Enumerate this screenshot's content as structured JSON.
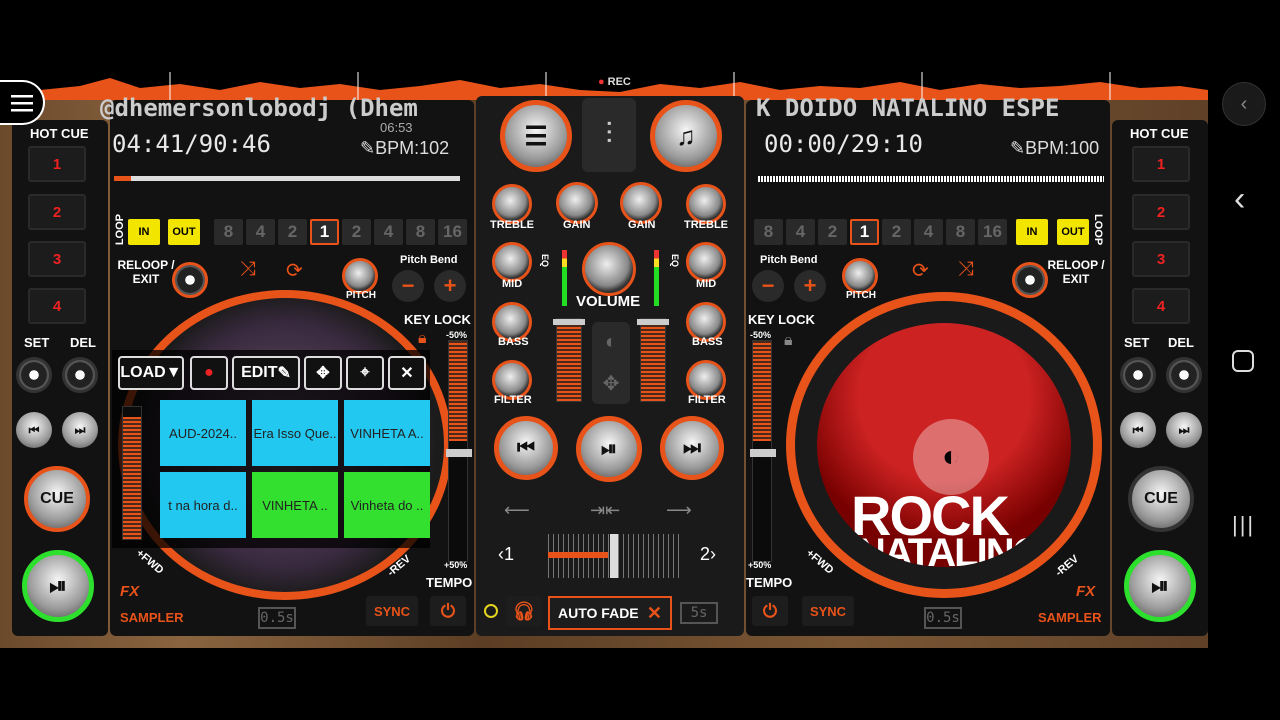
{
  "app": {
    "rec_label": "REC",
    "time": "06:53"
  },
  "deckA": {
    "title": "@dhemersonlobodj (Dhem",
    "time": "04:41/90:46",
    "bpm": "BPM:102",
    "progress": 0.05,
    "hotcue_title": "HOT CUE",
    "hotcues": [
      "1",
      "2",
      "3",
      "4"
    ],
    "set": "SET",
    "del": "DEL",
    "loop_label": "LOOP",
    "in": "IN",
    "out": "OUT",
    "loop_sizes": [
      "8",
      "4",
      "2",
      "1",
      "2",
      "4",
      "8",
      "16"
    ],
    "reloop": "RELOOP / EXIT",
    "pitch_bend": "Pitch Bend",
    "pitch": "PITCH",
    "minus": "−",
    "plus": "+",
    "key_lock": "KEY LOCK",
    "pitch_top": "-50%",
    "pitch_bottom": "+50%",
    "tempo": "TEMPO",
    "sync": "SYNC",
    "fx": "FX",
    "sampler": "SAMPLER",
    "fwd": "+FWD",
    "rev": "-REV",
    "cue": "CUE",
    "beat": "0.5s"
  },
  "deckB": {
    "title": "K DOIDO NATALINO ESPE",
    "time": "00:00/29:10",
    "bpm": "BPM:100",
    "hotcue_title": "HOT CUE",
    "hotcues": [
      "1",
      "2",
      "3",
      "4"
    ],
    "set": "SET",
    "del": "DEL",
    "loop_label": "LOOP",
    "in": "IN",
    "out": "OUT",
    "loop_sizes": [
      "8",
      "4",
      "2",
      "1",
      "2",
      "4",
      "8",
      "16"
    ],
    "reloop": "RELOOP / EXIT",
    "pitch_bend": "Pitch Bend",
    "pitch": "PITCH",
    "minus": "−",
    "plus": "+",
    "key_lock": "KEY LOCK",
    "pitch_top": "-50%",
    "pitch_bottom": "+50%",
    "tempo": "TEMPO",
    "sync": "SYNC",
    "fx": "FX",
    "sampler": "SAMPLER",
    "fwd": "+FWD",
    "rev": "-REV",
    "cue": "CUE",
    "beat": "0.5s",
    "art_text1": "ROCK",
    "art_text2": "NATALINO"
  },
  "mixer": {
    "treble": "TREBLE",
    "gain": "GAIN",
    "mid": "MID",
    "bass": "BASS",
    "filter": "FILTER",
    "eq": "EQ",
    "volume": "VOLUME",
    "auto_fade": "AUTO FADE",
    "auto_fade_time": "5s",
    "cross_left": "‹1",
    "cross_right": "2›",
    "crossfader_position": 0.5
  },
  "sampler": {
    "load": "LOAD▼",
    "edit": "EDIT",
    "pads": [
      {
        "label": "AUD-2024..",
        "color": "blue"
      },
      {
        "label": "Era Isso Que..",
        "color": "blue"
      },
      {
        "label": "VINHETA A..",
        "color": "blue"
      },
      {
        "label": "t na hora d..",
        "color": "blue"
      },
      {
        "label": "VINHETA ..",
        "color": "green"
      },
      {
        "label": "Vinheta do ..",
        "color": "green"
      }
    ]
  }
}
